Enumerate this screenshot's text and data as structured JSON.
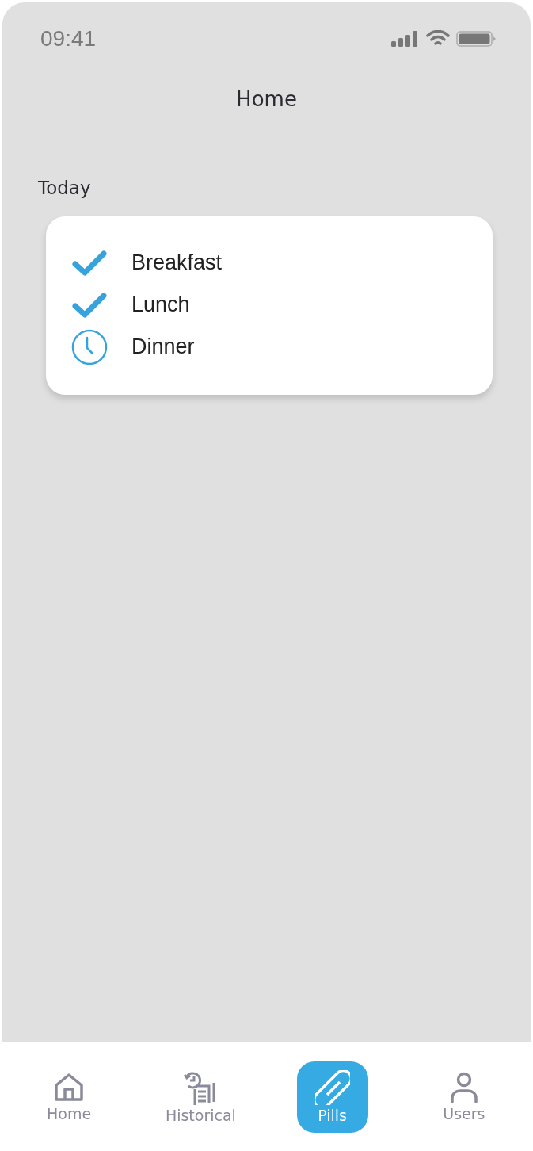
{
  "status_bar": {
    "time": "09:41"
  },
  "header": {
    "title": "Home"
  },
  "section": {
    "title": "Today"
  },
  "meals": [
    {
      "label": "Breakfast",
      "done": true
    },
    {
      "label": "Lunch",
      "done": true
    },
    {
      "label": "Dinner",
      "done": false
    }
  ],
  "tabs": [
    {
      "label": "Home",
      "kind": "home",
      "selected": false
    },
    {
      "label": "Historical",
      "kind": "history",
      "selected": false
    },
    {
      "label": "Pills",
      "kind": "pills",
      "selected": true
    },
    {
      "label": "Users",
      "kind": "user",
      "selected": false
    }
  ]
}
